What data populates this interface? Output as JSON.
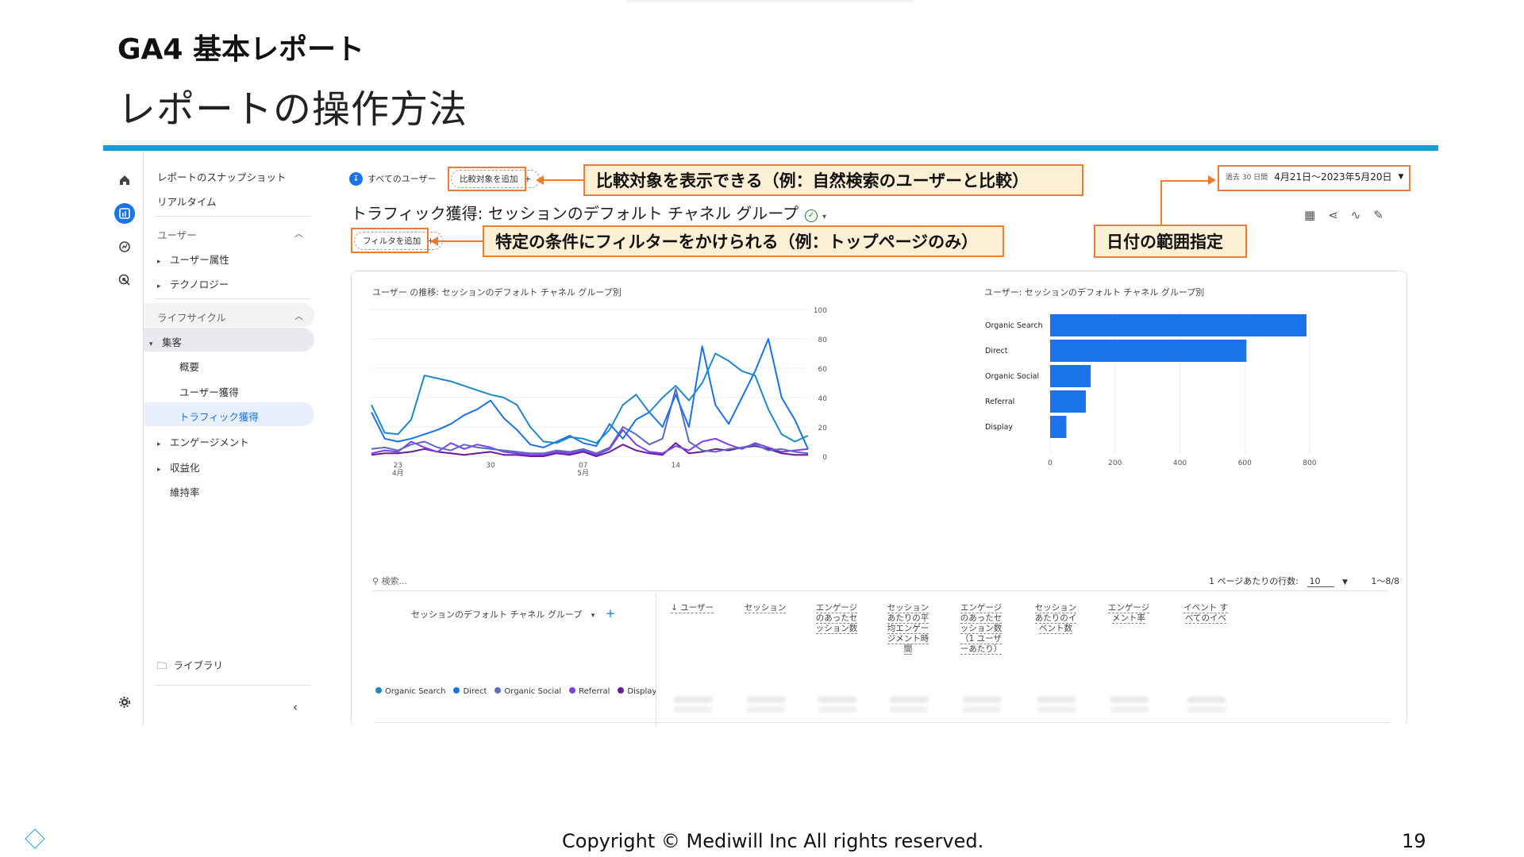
{
  "slide": {
    "title": "GA4 基本レポート",
    "subtitle": "レポートの操作方法",
    "copyright": "Copyright © Mediwill Inc All rights reserved.",
    "page_number": "19"
  },
  "colors": {
    "accent_bar": "#1a9ad6",
    "callout_border": "#ed7d31",
    "callout_fill": "#fdf0d5",
    "ga_blue": "#1a73e8"
  },
  "rail_icons": [
    "home-icon",
    "reports-icon",
    "explore-icon",
    "advertising-icon",
    "settings-icon"
  ],
  "nav": {
    "snapshot": "レポートのスナップショット",
    "realtime": "リアルタイム",
    "user_section": "ユーザー",
    "user_attributes": "ユーザー属性",
    "technology": "テクノロジー",
    "lifecycle": "ライフサイクル",
    "acquisition": "集客",
    "overview": "概要",
    "user_acquisition": "ユーザー獲得",
    "traffic_acquisition": "トラフィック獲得",
    "engagement": "エンゲージメント",
    "monetization": "収益化",
    "retention": "維持率",
    "library": "ライブラリ"
  },
  "header": {
    "all_users": "すべてのユーザー",
    "compare_chip": "比較対象を追加",
    "filter_chip": "フィルタを追加",
    "report_title": "トラフィック獲得: セッションのデフォルト チャネル グループ",
    "date_prefix": "過去 30 日間",
    "date_range": "4月21日～2023年5月20日"
  },
  "callouts": {
    "compare": "比較対象を表示できる（例：自然検索のユーザーと比較）",
    "filter": "特定の条件にフィルターをかけられる（例：トップページのみ）",
    "date": "日付の範囲指定"
  },
  "chart_data": [
    {
      "type": "line",
      "title": "ユーザー の推移: セッションのデフォルト チャネル グループ別",
      "x_ticks": [
        "23\n4月",
        "30",
        "07\n5月",
        "14"
      ],
      "ylim": [
        0,
        100
      ],
      "y_ticks": [
        0,
        20,
        40,
        60,
        80,
        100
      ],
      "series": [
        {
          "name": "Organic Search",
          "color": "#1e88c9",
          "values": [
            35,
            16,
            15,
            25,
            55,
            53,
            51,
            48,
            45,
            42,
            40,
            35,
            20,
            10,
            9,
            13,
            12,
            9,
            18,
            35,
            42,
            30,
            40,
            48,
            38,
            50,
            70,
            65,
            58,
            55,
            32,
            15,
            10,
            14
          ]
        },
        {
          "name": "Direct",
          "color": "#1a73e8",
          "values": [
            30,
            12,
            10,
            12,
            15,
            18,
            22,
            28,
            32,
            38,
            26,
            18,
            8,
            6,
            10,
            14,
            9,
            7,
            22,
            12,
            25,
            30,
            20,
            42,
            20,
            75,
            35,
            22,
            40,
            58,
            80,
            40,
            25,
            5
          ]
        },
        {
          "name": "Organic Social",
          "color": "#5c6bc0",
          "values": [
            5,
            6,
            4,
            8,
            10,
            6,
            4,
            8,
            6,
            5,
            4,
            3,
            2,
            2,
            4,
            3,
            5,
            2,
            6,
            20,
            15,
            8,
            12,
            46,
            10,
            4,
            3,
            5,
            6,
            8,
            4,
            5,
            3,
            2
          ]
        },
        {
          "name": "Referral",
          "color": "#7e3ff2",
          "values": [
            2,
            4,
            3,
            10,
            6,
            3,
            9,
            5,
            8,
            6,
            3,
            2,
            1,
            1,
            3,
            2,
            4,
            1,
            5,
            18,
            8,
            3,
            2,
            7,
            4,
            10,
            12,
            8,
            5,
            9,
            6,
            3,
            4,
            5
          ]
        },
        {
          "name": "Display",
          "color": "#6a1b9a",
          "values": [
            1,
            2,
            2,
            3,
            5,
            3,
            2,
            1,
            2,
            3,
            1,
            1,
            0,
            0,
            2,
            1,
            3,
            0,
            3,
            8,
            4,
            2,
            1,
            9,
            2,
            3,
            5,
            4,
            6,
            7,
            5,
            2,
            1,
            1
          ]
        }
      ]
    },
    {
      "type": "bar",
      "title": "ユーザー: セッションのデフォルト チャネル グループ別",
      "categories": [
        "Organic Search",
        "Direct",
        "Organic Social",
        "Referral",
        "Display"
      ],
      "values": [
        790,
        605,
        125,
        110,
        50
      ],
      "xlim": [
        0,
        800
      ],
      "x_ticks": [
        0,
        200,
        400,
        600,
        800
      ],
      "color": "#1a73e8"
    }
  ],
  "table": {
    "search_placeholder": "検索...",
    "rows_per_page_label": "1 ページあたりの行数:",
    "rows_per_page": "10",
    "page_range": "1～8/8",
    "dimension_header": "セッションのデフォルト チャネル グループ",
    "columns": [
      "↓ ユーザー",
      "セッション",
      "エンゲージのあったセッション数",
      "セッションあたりの平均エンゲージメント時間",
      "エンゲージのあったセッション数（1 ユーザーあたり）",
      "セッションあたりのイベント数",
      "エンゲージメント率",
      "イベント すべてのイベ"
    ]
  }
}
